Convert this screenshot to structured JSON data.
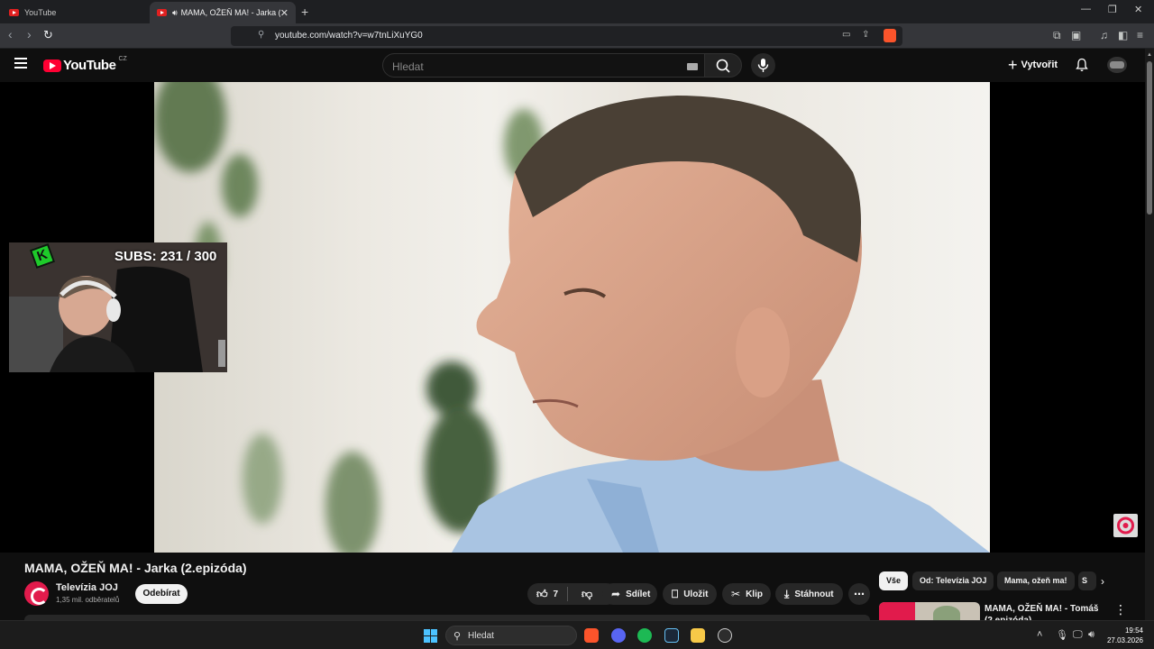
{
  "browser": {
    "tabs": [
      {
        "title": "YouTube",
        "active": false
      },
      {
        "title": "MAMA, OŽEŇ MA! - Jarka (2.e",
        "active": true
      }
    ],
    "url": "youtube.com/watch?v=w7tnLiXuYG0"
  },
  "masthead": {
    "logo_text": "YouTube",
    "country_code": "CZ",
    "search_placeholder": "Hledat",
    "create_label": "Vytvořit"
  },
  "overlay": {
    "subs_text": "SUBS: 231 / 300",
    "logo_letter": "K"
  },
  "video": {
    "title": "MAMA, OŽEŇ MA! - Jarka (2.epizóda)",
    "channel_name": "Televízia JOJ",
    "channel_subs": "1,35 mil. odběratelů",
    "subscribe_label": "Odebírat",
    "like_count": "7",
    "share_label": "Sdílet",
    "save_label": "Uložit",
    "clip_label": "Klip",
    "download_label": "Stáhnout"
  },
  "sidebar": {
    "chips": [
      "Vše",
      "Od: Televízia JOJ",
      "Mama, ožeň ma!",
      "S"
    ],
    "recommendation_title": "MAMA, OŽEŇ MA! - Tomáš (2.epizóda)"
  },
  "taskbar": {
    "search_placeholder": "Hledat",
    "time": "19:54",
    "date": "27.03.2026"
  },
  "colors": {
    "yt_red": "#ff0033",
    "joj_red": "#e11b4c",
    "overlay_green": "#1ecb2a"
  }
}
